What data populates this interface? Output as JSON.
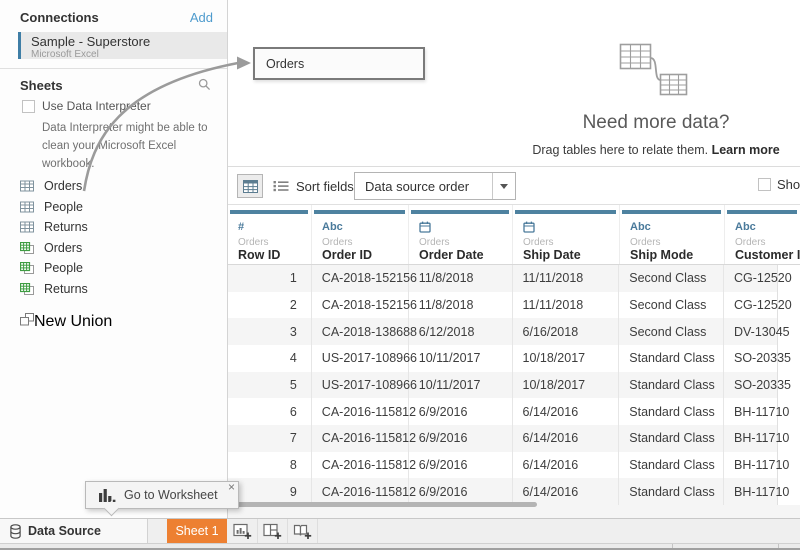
{
  "colors": {
    "accent_orange": "#ED8032",
    "header_bar_blue": "#4E82A0",
    "field_icon_blue": "#4A7A9B",
    "link_blue": "#4E9BCD",
    "connection_accent_blue": "#3F7EA6"
  },
  "sidebar": {
    "connections_title": "Connections",
    "add_link": "Add",
    "connection": {
      "name": "Sample - Superstore",
      "subtitle": "Microsoft Excel"
    },
    "sheets_title": "Sheets",
    "use_data_interpreter": "Use Data Interpreter",
    "interpreter_hint": "Data Interpreter might be able to clean your Microsoft Excel workbook.",
    "sheet_items": [
      {
        "label": "Orders",
        "icon": "table-sheet-icon"
      },
      {
        "label": "People",
        "icon": "table-sheet-icon"
      },
      {
        "label": "Returns",
        "icon": "table-sheet-icon"
      },
      {
        "label": "Orders",
        "icon": "named-range-icon"
      },
      {
        "label": "People",
        "icon": "named-range-icon"
      },
      {
        "label": "Returns",
        "icon": "named-range-icon"
      }
    ],
    "new_union_label": "New Union"
  },
  "canvas": {
    "dragged_table_label": "Orders",
    "empty_state_title": "Need more data?",
    "empty_state_text": "Drag tables here to relate them.",
    "empty_state_link": "Learn more"
  },
  "toolbar": {
    "sort_fields_label": "Sort fields",
    "sort_order_value": "Data source order",
    "show_label": "Show"
  },
  "grid": {
    "columns": [
      {
        "type": "number",
        "table": "Orders",
        "name": "Row ID"
      },
      {
        "type": "string",
        "table": "Orders",
        "name": "Order ID"
      },
      {
        "type": "date",
        "table": "Orders",
        "name": "Order Date"
      },
      {
        "type": "date",
        "table": "Orders",
        "name": "Ship Date"
      },
      {
        "type": "string",
        "table": "Orders",
        "name": "Ship Mode"
      },
      {
        "type": "string",
        "table": "Orders",
        "name": "Customer ID"
      }
    ],
    "rows": [
      [
        "1",
        "CA-2018-152156",
        "11/8/2018",
        "11/11/2018",
        "Second Class",
        "CG-12520"
      ],
      [
        "2",
        "CA-2018-152156",
        "11/8/2018",
        "11/11/2018",
        "Second Class",
        "CG-12520"
      ],
      [
        "3",
        "CA-2018-138688",
        "6/12/2018",
        "6/16/2018",
        "Second Class",
        "DV-13045"
      ],
      [
        "4",
        "US-2017-108966",
        "10/11/2017",
        "10/18/2017",
        "Standard Class",
        "SO-20335"
      ],
      [
        "5",
        "US-2017-108966",
        "10/11/2017",
        "10/18/2017",
        "Standard Class",
        "SO-20335"
      ],
      [
        "6",
        "CA-2016-115812",
        "6/9/2016",
        "6/14/2016",
        "Standard Class",
        "BH-11710"
      ],
      [
        "7",
        "CA-2016-115812",
        "6/9/2016",
        "6/14/2016",
        "Standard Class",
        "BH-11710"
      ],
      [
        "8",
        "CA-2016-115812",
        "6/9/2016",
        "6/14/2016",
        "Standard Class",
        "BH-11710"
      ],
      [
        "9",
        "CA-2016-115812",
        "6/9/2016",
        "6/14/2016",
        "Standard Class",
        "BH-11710"
      ]
    ]
  },
  "tooltip": {
    "label": "Go to Worksheet",
    "close": "×"
  },
  "bottom_bar": {
    "data_source_tab": "Data Source",
    "sheet_tab": "Sheet 1"
  }
}
